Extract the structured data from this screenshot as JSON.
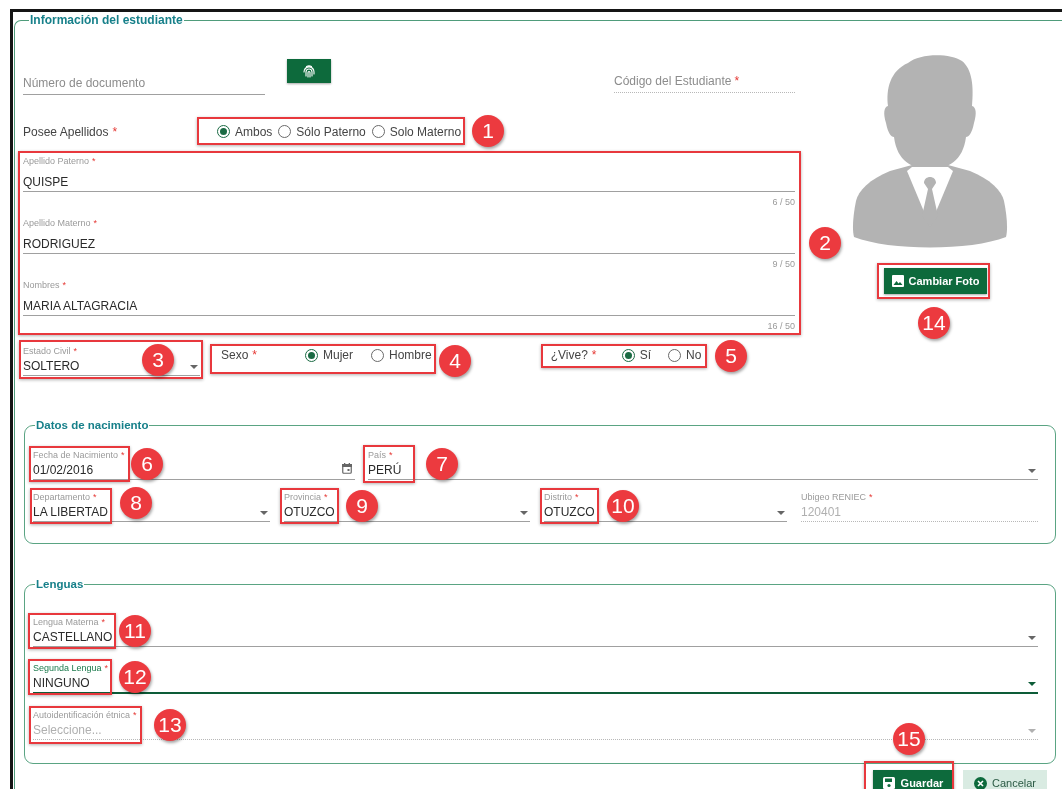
{
  "student_info": {
    "title": "Información del estudiante",
    "document_field": {
      "label": "Número de documento"
    },
    "student_code_field": {
      "label": "Código del Estudiante",
      "required_mark": "*",
      "disabled": true
    },
    "has_surnames": {
      "label": "Posee Apellidos",
      "required_mark": "*",
      "options": [
        {
          "label": "Ambos",
          "selected": true
        },
        {
          "label": "Sólo Paterno",
          "selected": false
        },
        {
          "label": "Solo Materno",
          "selected": false
        }
      ]
    },
    "name_fields": [
      {
        "label": "Apellido Paterno",
        "required_mark": "*",
        "value": "QUISPE",
        "counter": "6 / 50"
      },
      {
        "label": "Apellido Materno",
        "required_mark": "*",
        "value": "RODRIGUEZ",
        "counter": "9 / 50"
      },
      {
        "label": "Nombres",
        "required_mark": "*",
        "value": "MARIA ALTAGRACIA",
        "counter": "16 / 50"
      }
    ],
    "photo": {
      "button": "Cambiar Foto"
    },
    "civil_status": {
      "label": "Estado Civil",
      "required_mark": "*",
      "value": "SOLTERO"
    },
    "sex": {
      "label": "Sexo",
      "required_mark": "*",
      "options": [
        {
          "label": "Mujer",
          "selected": true
        },
        {
          "label": "Hombre",
          "selected": false
        }
      ]
    },
    "alive": {
      "label": "¿Vive?",
      "required_mark": "*",
      "options": [
        {
          "label": "Sí",
          "selected": true
        },
        {
          "label": "No",
          "selected": false
        }
      ]
    }
  },
  "birth_data": {
    "title": "Datos de nacimiento",
    "fields": [
      {
        "kind": "date",
        "label": "Fecha de Nacimiento",
        "required_mark": "*",
        "value": "01/02/2016",
        "disabled": false
      },
      {
        "kind": "select",
        "label": "País",
        "required_mark": "*",
        "value": "PERÚ",
        "disabled": false
      },
      {
        "kind": "select",
        "label": "Departamento",
        "required_mark": "*",
        "value": "LA LIBERTAD",
        "disabled": false
      },
      {
        "kind": "select",
        "label": "Provincia",
        "required_mark": "*",
        "value": "OTUZCO",
        "disabled": false
      },
      {
        "kind": "select",
        "label": "Distrito",
        "required_mark": "*",
        "value": "OTUZCO",
        "disabled": false
      },
      {
        "kind": "text",
        "label": "Ubigeo RENIEC",
        "required_mark": "*",
        "value": "120401",
        "disabled": true
      }
    ]
  },
  "languages": {
    "title": "Lenguas",
    "fields": [
      {
        "kind": "select",
        "label": "Lengua Materna",
        "required_mark": "*",
        "value": "CASTELLANO",
        "focused": false,
        "disabled": false
      },
      {
        "kind": "select",
        "label": "Segunda Lengua",
        "required_mark": "*",
        "value": "NINGUNO",
        "focused": true,
        "disabled": false
      },
      {
        "kind": "select",
        "label": "Autoidentificación étnica",
        "required_mark": "*",
        "placeholder": "Seleccione...",
        "focused": false,
        "disabled": true
      }
    ]
  },
  "actions": [
    {
      "kind": "primary",
      "label": "Guardar"
    },
    {
      "kind": "secondary",
      "label": "Cancelar"
    }
  ],
  "annotations": [
    {
      "number": "1"
    },
    {
      "number": "2"
    },
    {
      "number": "3"
    },
    {
      "number": "4"
    },
    {
      "number": "5"
    },
    {
      "number": "6"
    },
    {
      "number": "7"
    },
    {
      "number": "8"
    },
    {
      "number": "9"
    },
    {
      "number": "10"
    },
    {
      "number": "11"
    },
    {
      "number": "12"
    },
    {
      "number": "13"
    },
    {
      "number": "14"
    },
    {
      "number": "15"
    }
  ]
}
